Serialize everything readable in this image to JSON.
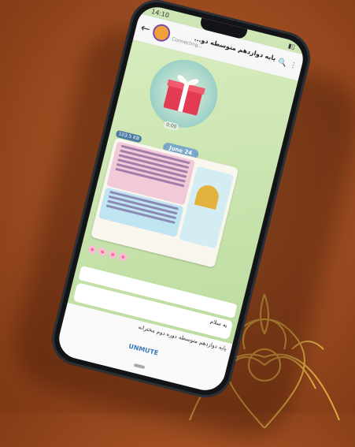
{
  "status": {
    "time": "14:10"
  },
  "chat": {
    "title": "پایه دوازدهم متوسطه دو...",
    "status": "Connecting..."
  },
  "messages": {
    "date": "June 24",
    "size_badge": "103.5 KB",
    "emojis": "🌸🌸🌸🌸",
    "text": "یه سلام"
  },
  "bottom": {
    "preview": "پایه دوازدهم متوسطه دوره دوم مخترانه",
    "unmute": "UNMUTE"
  },
  "colors": {
    "accent": "#3a7ab8",
    "gift": "#e23b52",
    "table": "#a24f22"
  }
}
